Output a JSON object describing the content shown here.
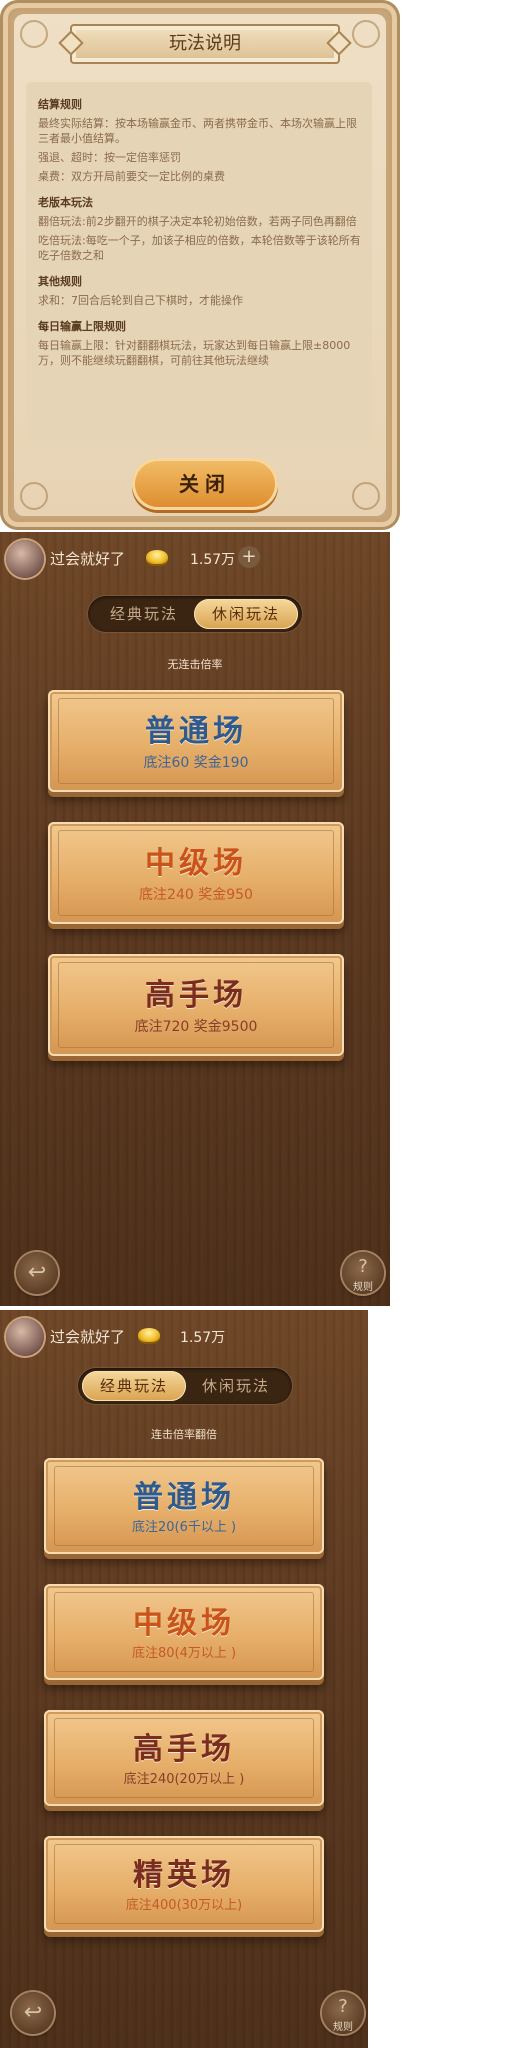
{
  "rules_dialog": {
    "title": "玩法说明",
    "sections": [
      {
        "heading": "结算规则",
        "lines": [
          "最终实际结算：按本场输赢金币、两者携带金币、本场次输赢上限三者最小值结算。",
          "强退、超时：按一定倍率惩罚",
          "桌费：双方开局前要交一定比例的桌费"
        ]
      },
      {
        "heading": "老版本玩法",
        "lines": [
          "翻倍玩法:前2步翻开的棋子决定本轮初始倍数，若两子同色再翻倍",
          "吃倍玩法:每吃一个子，加该子相应的倍数，本轮倍数等于该轮所有吃子倍数之和"
        ]
      },
      {
        "heading": "其他规则",
        "lines": [
          "求和：7回合后轮到自己下棋时，才能操作"
        ]
      },
      {
        "heading": "每日输赢上限规则",
        "lines": [
          "每日输赢上限：针对翻翻棋玩法，玩家达到每日输赢上限±8000万，则不能继续玩翻翻棋，可前往其他玩法继续"
        ]
      }
    ],
    "close_label": "关闭"
  },
  "casual_screen": {
    "user": {
      "nickname": "过会就好了",
      "coins": "1.57万"
    },
    "tabs": [
      {
        "label": "经典玩法"
      },
      {
        "label": "休闲玩法"
      }
    ],
    "active_tab": "休闲玩法",
    "subtitle": "无连击倍率",
    "rooms": [
      {
        "name": "普通场",
        "detail": "底注60  奖金190"
      },
      {
        "name": "中级场",
        "detail": "底注240  奖金950"
      },
      {
        "name": "高手场",
        "detail": "底注720  奖金9500"
      }
    ],
    "help_label": "规则"
  },
  "classic_screen": {
    "user": {
      "nickname": "过会就好了",
      "coins": "1.57万"
    },
    "tabs": [
      {
        "label": "经典玩法"
      },
      {
        "label": "休闲玩法"
      }
    ],
    "active_tab": "经典玩法",
    "subtitle": "连击倍率翻倍",
    "rooms": [
      {
        "name": "普通场",
        "detail": "底注20(6千以上 )"
      },
      {
        "name": "中级场",
        "detail": "底注80(4万以上 )"
      },
      {
        "name": "高手场",
        "detail": "底注240(20万以上 )"
      },
      {
        "name": "精英场",
        "detail": "底注400(30万以上)"
      }
    ],
    "help_label": "规则"
  },
  "colors": {
    "wood_dark": "#5c3920",
    "room_button": "#e6af6a",
    "accent_gold": "#d9a351",
    "text_blue": "#2e5a8d",
    "text_orange": "#c9531a",
    "text_maroon": "#7a2d1e"
  },
  "icons": {
    "back": "back-arrow-icon",
    "help": "question-mark-icon",
    "coin": "gold-ingot-icon",
    "add": "plus-icon"
  }
}
